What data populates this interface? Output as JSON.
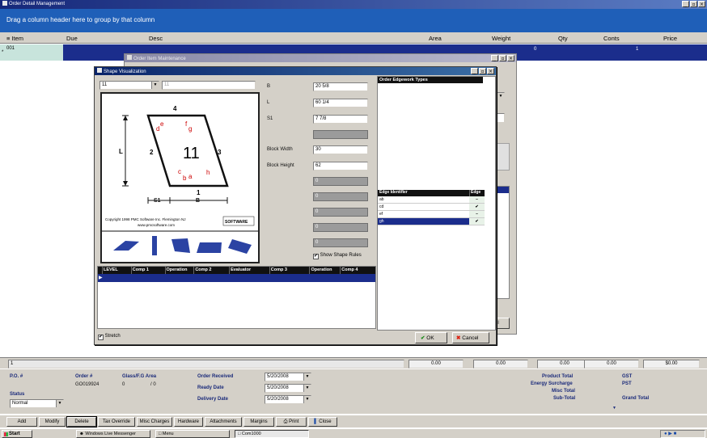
{
  "main_window": {
    "title": "Order Detail Management"
  },
  "group_bar": {
    "text": "Drag a column header here to group by that column"
  },
  "grid": {
    "columns": [
      "Item",
      "Due",
      "Desc",
      "Area",
      "Weight",
      "Qty",
      "Conts",
      "Price"
    ],
    "row": {
      "item": "001",
      "qty": "0",
      "conts": "1"
    }
  },
  "totals_row": {
    "item": "1",
    "area": "0.00",
    "weight": "0.00",
    "qty": "0.00",
    "conts": "0.00",
    "price": "$0.00"
  },
  "order_form": {
    "po_label": "P.O. #",
    "order_label": "Order #",
    "order_value": "GO019924",
    "glass_label": "Glass/F.G Area",
    "glass_value_1": "0",
    "glass_value_2": "/ 0",
    "status_label": "Status",
    "status_value": "Normal",
    "order_received_label": "Order Received",
    "order_received_value": "5/20/2008",
    "ready_date_label": "Ready Date",
    "ready_date_value": "5/20/2008",
    "delivery_date_label": "Delivery Date",
    "delivery_date_value": "5/20/2008",
    "product_total_label": "Product Total",
    "energy_surcharge_label": "Energy Surcharge",
    "misc_total_label": "Misc Total",
    "sub_total_label": "Sub-Total",
    "gst_label": "GST",
    "pst_label": "PST",
    "grand_total_label": "Grand Total"
  },
  "toolbar": [
    "Add",
    "Modify",
    "Delete",
    "Tax Override",
    "Misc Charges",
    "Hardware",
    "Attachments",
    "Margins",
    "Print",
    "Close"
  ],
  "taskbar": {
    "start": "Start",
    "items": [
      "Windows Live Messenger",
      "Menu",
      "Com1000"
    ]
  },
  "item_maintenance": {
    "title": "Order Item Maintenance",
    "cancel_fragment": "cel"
  },
  "shape_window": {
    "title": "Shape Visualization",
    "shape_select": "11",
    "shape_field_2": "11",
    "params": [
      {
        "label": "B",
        "value": "20 5/8"
      },
      {
        "label": "L",
        "value": "60 1/4"
      },
      {
        "label": "S1",
        "value": "7 7/8"
      }
    ],
    "block_width_label": "Block Width",
    "block_width_value": "30",
    "block_height_label": "Block Height",
    "block_height_value": "62",
    "disabled_value": "0",
    "show_shape_rules": "Show Shape Rules",
    "edgework_header": "Order Edgework Types",
    "edge_table": {
      "headers": [
        "Edge Identifier",
        "Edge"
      ],
      "rows": [
        {
          "id": "ab",
          "mark": "–"
        },
        {
          "id": "cd",
          "mark": "✔"
        },
        {
          "id": "ef",
          "mark": "–"
        },
        {
          "id": "gh",
          "mark": "✔"
        }
      ]
    },
    "rules_headers": [
      "LEVEL",
      "Comp 1",
      "Operation",
      "Comp 2",
      "Evaluator",
      "Comp 3",
      "Operation",
      "Comp 4"
    ],
    "stretch_label": "Stretch",
    "ok_label": "OK",
    "cancel_label": "Cancel",
    "diagram": {
      "shape_number": "11",
      "side_labels": [
        "1",
        "2",
        "3",
        "4"
      ],
      "corner_letters": [
        "a",
        "b",
        "c",
        "d",
        "e",
        "f",
        "g",
        "h"
      ],
      "dim_labels": [
        "L",
        "S1",
        "B"
      ],
      "copyright": "Copyright 1998 PMC Software Inc. Flemington NJ",
      "website": "www.pmcsoftware.com",
      "logo_text": "SOFTWARE"
    }
  }
}
